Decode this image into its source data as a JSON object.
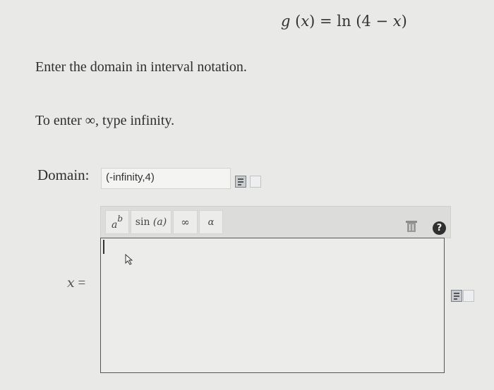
{
  "header": {
    "formula_g": "g",
    "formula_x1": "x",
    "formula_mid": ") = ln (4 − ",
    "formula_x2": "x",
    "formula_end": ")"
  },
  "prompt": {
    "line1": "Enter the domain in interval notation.",
    "line2": "To enter ∞, type infinity."
  },
  "domain": {
    "label": "Domain:",
    "value": "(-infinity,4)"
  },
  "toolbar": {
    "power_base": "a",
    "power_exp": "b",
    "sin_label": "sin",
    "sin_arg": "(a)",
    "infinity_label": "∞",
    "alpha_label": "α",
    "help_label": "?"
  },
  "answer": {
    "variable": "x",
    "equals": "="
  },
  "icons": {
    "doc_a": "document-icon",
    "doc_b": "page-icon",
    "trash": "trash-icon",
    "help": "help-icon",
    "pointer": "mouse-pointer-icon"
  }
}
